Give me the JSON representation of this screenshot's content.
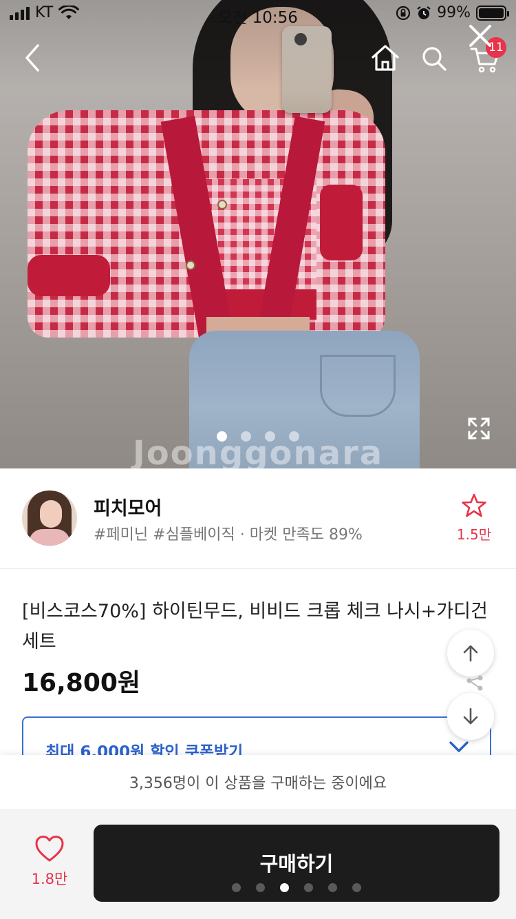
{
  "status_bar": {
    "carrier": "KT",
    "time": "오전 10:56",
    "battery": "99%",
    "battery_level": 0.99
  },
  "nav": {
    "cart_badge": "11",
    "icons": [
      "back-icon",
      "home-icon",
      "search-icon",
      "cart-icon",
      "close-icon"
    ]
  },
  "gallery": {
    "watermark": "Joonggonara",
    "page_count": 4,
    "active_page": 1,
    "expand_icon": "expand-icon"
  },
  "seller": {
    "name": "피치모어",
    "tags": "#페미닌 #심플베이직 · 마켓 만족도 89%",
    "favorite_count": "1.5만"
  },
  "product": {
    "title": "[비스코스70%] 하이틴무드, 비비드 크롭 체크 나시+가디건 세트",
    "price": "16,800원"
  },
  "coupon": {
    "label": "최대 6,000원 할인 쿠폰받기"
  },
  "notice": "3,356명이 이 상품을 구매하는 중이에요",
  "bottom": {
    "like_count": "1.8만",
    "buy_label": "구매하기",
    "pager_count": 6,
    "pager_active": 3
  },
  "colors": {
    "accent_red": "#e8334a",
    "coupon_blue": "#2c62cc",
    "buy_button": "#1c1c1c"
  }
}
